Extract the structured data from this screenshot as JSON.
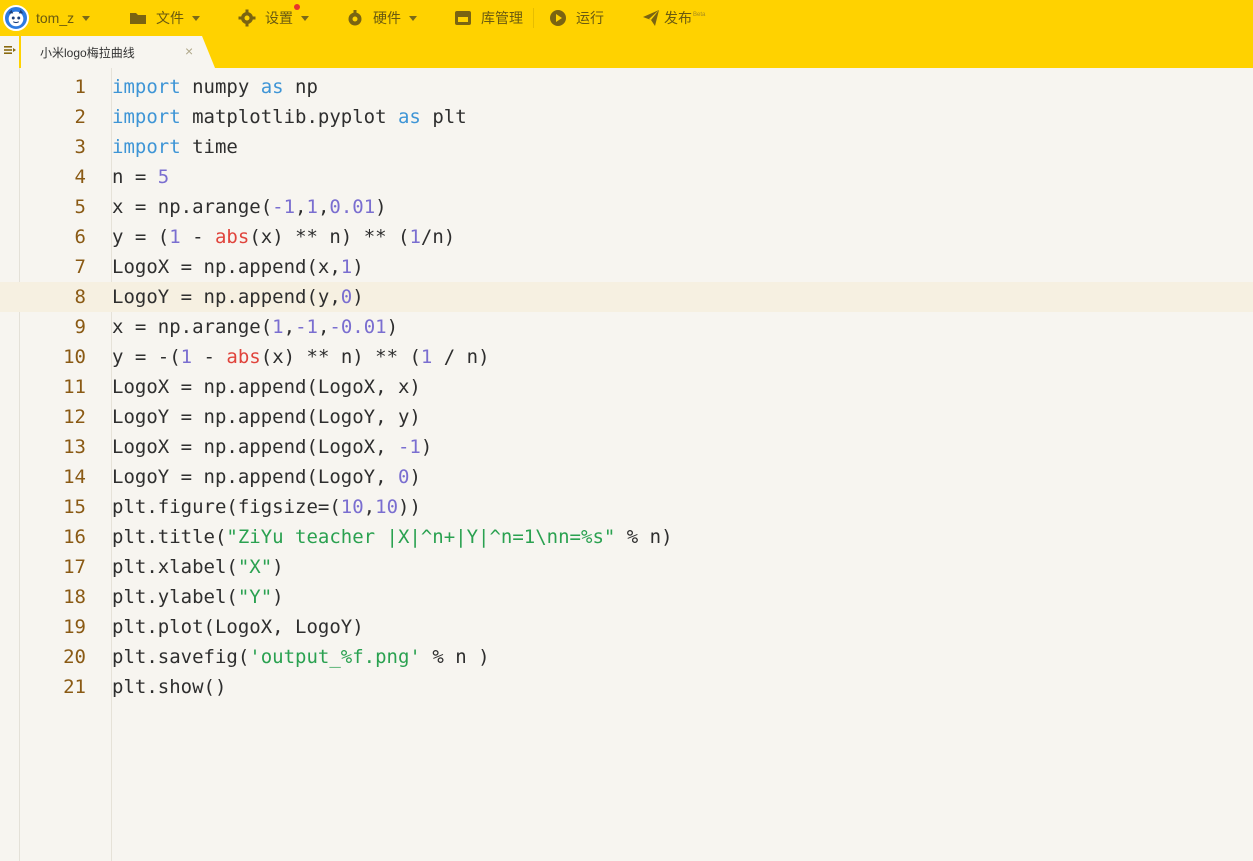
{
  "toolbar": {
    "user": {
      "name": "tom_z",
      "avatar_icon": "user-avatar-icon"
    },
    "items": [
      {
        "label": "文件",
        "icon": "folder-icon"
      },
      {
        "label": "设置",
        "icon": "gear-icon"
      },
      {
        "label": "硬件",
        "icon": "hardware-icon"
      },
      {
        "label": "库管理",
        "icon": "library-icon"
      },
      {
        "label": "运行",
        "icon": "play-icon"
      },
      {
        "label": "发布",
        "icon": "paper-plane-icon",
        "badge": "Beta"
      }
    ]
  },
  "tab": {
    "title": "小米logo梅拉曲线",
    "close": "×"
  },
  "editor": {
    "active_line": 8,
    "lines": [
      [
        [
          "kw",
          "import"
        ],
        [
          "p",
          " numpy "
        ],
        [
          "kw",
          "as"
        ],
        [
          "p",
          " np"
        ]
      ],
      [
        [
          "kw",
          "import"
        ],
        [
          "p",
          " matplotlib.pyplot "
        ],
        [
          "kw",
          "as"
        ],
        [
          "p",
          " plt"
        ]
      ],
      [
        [
          "kw",
          "import"
        ],
        [
          "p",
          " time"
        ]
      ],
      [
        [
          "p",
          "n = "
        ],
        [
          "num",
          "5"
        ]
      ],
      [
        [
          "p",
          "x = np.arange("
        ],
        [
          "num",
          "-1"
        ],
        [
          "p",
          ","
        ],
        [
          "num",
          "1"
        ],
        [
          "p",
          ","
        ],
        [
          "num",
          "0.01"
        ],
        [
          "p",
          ")"
        ]
      ],
      [
        [
          "p",
          "y = ("
        ],
        [
          "num",
          "1"
        ],
        [
          "p",
          " - "
        ],
        [
          "fn",
          "abs"
        ],
        [
          "p",
          "(x) ** n) ** ("
        ],
        [
          "num",
          "1"
        ],
        [
          "p",
          "/n)"
        ]
      ],
      [
        [
          "p",
          "LogoX = np.append(x,"
        ],
        [
          "num",
          "1"
        ],
        [
          "p",
          ")"
        ]
      ],
      [
        [
          "p",
          "LogoY = np.append(y,"
        ],
        [
          "num",
          "0"
        ],
        [
          "p",
          ")"
        ]
      ],
      [
        [
          "p",
          "x = np.arange("
        ],
        [
          "num",
          "1"
        ],
        [
          "p",
          ","
        ],
        [
          "num",
          "-1"
        ],
        [
          "p",
          ","
        ],
        [
          "num",
          "-0.01"
        ],
        [
          "p",
          ")"
        ]
      ],
      [
        [
          "p",
          "y = -("
        ],
        [
          "num",
          "1"
        ],
        [
          "p",
          " - "
        ],
        [
          "fn",
          "abs"
        ],
        [
          "p",
          "(x) ** n) ** ("
        ],
        [
          "num",
          "1"
        ],
        [
          "p",
          " / n)"
        ]
      ],
      [
        [
          "p",
          "LogoX = np.append(LogoX, x)"
        ]
      ],
      [
        [
          "p",
          "LogoY = np.append(LogoY, y)"
        ]
      ],
      [
        [
          "p",
          "LogoX = np.append(LogoX, "
        ],
        [
          "num",
          "-1"
        ],
        [
          "p",
          ")"
        ]
      ],
      [
        [
          "p",
          "LogoY = np.append(LogoY, "
        ],
        [
          "num",
          "0"
        ],
        [
          "p",
          ")"
        ]
      ],
      [
        [
          "p",
          "plt.figure(figsize=("
        ],
        [
          "num",
          "10"
        ],
        [
          "p",
          ","
        ],
        [
          "num",
          "10"
        ],
        [
          "p",
          "))"
        ]
      ],
      [
        [
          "p",
          "plt.title("
        ],
        [
          "str",
          "\"ZiYu teacher |X|^n+|Y|^n=1\\nn=%s\""
        ],
        [
          "p",
          " % n)"
        ]
      ],
      [
        [
          "p",
          "plt.xlabel("
        ],
        [
          "str",
          "\"X\""
        ],
        [
          "p",
          ")"
        ]
      ],
      [
        [
          "p",
          "plt.ylabel("
        ],
        [
          "str",
          "\"Y\""
        ],
        [
          "p",
          ")"
        ]
      ],
      [
        [
          "p",
          "plt.plot(LogoX, LogoY)"
        ]
      ],
      [
        [
          "p",
          "plt.savefig("
        ],
        [
          "str",
          "'output_%f.png'"
        ],
        [
          "p",
          " % n )"
        ]
      ],
      [
        [
          "p",
          "plt.show()"
        ]
      ]
    ]
  },
  "colors": {
    "toolbar_bg": "#ffd200",
    "editor_bg": "#f7f5f0",
    "line_number": "#8a5a14",
    "keyword": "#3e95d6",
    "number": "#7a6ed0",
    "builtin": "#e0443c",
    "string": "#2aa150",
    "active_line_bg": "#f6f0e1"
  }
}
